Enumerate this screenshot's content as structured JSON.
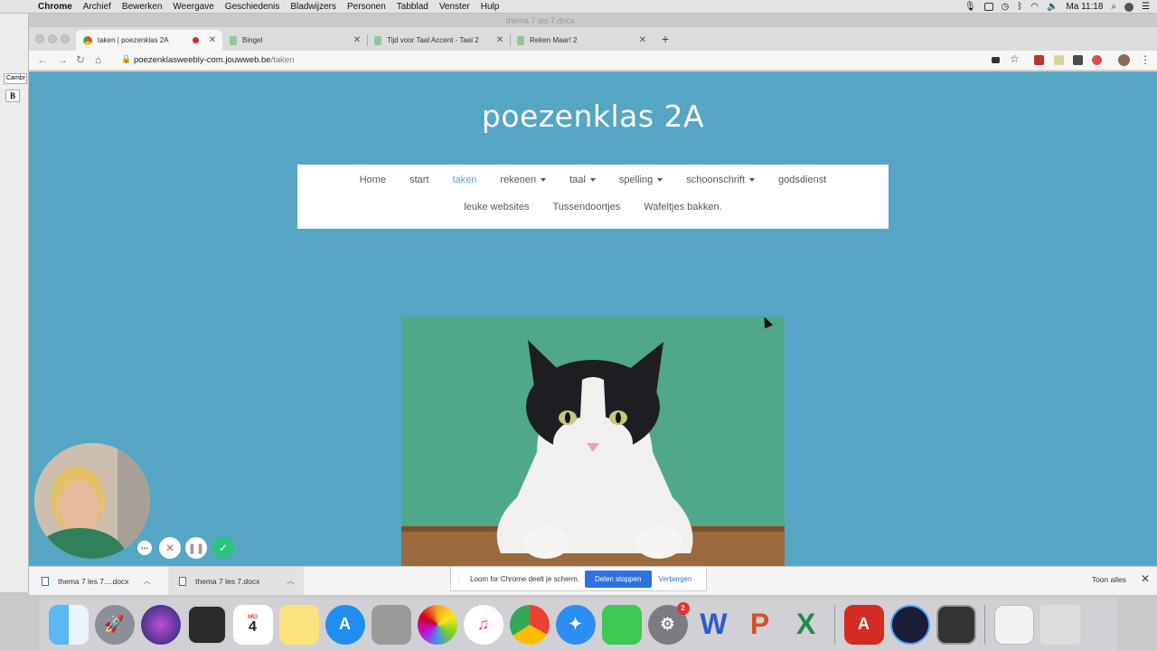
{
  "menubar": {
    "app": "Chrome",
    "items": [
      "Archief",
      "Bewerken",
      "Weergave",
      "Geschiedenis",
      "Bladwijzers",
      "Personen",
      "Tabblad",
      "Venster",
      "Hulp"
    ],
    "clock": "Ma 11:18"
  },
  "background_window": {
    "title": "thema 7 les 7.docx",
    "font_value": "Cambr",
    "bold_label": "B"
  },
  "browser": {
    "tabs": [
      {
        "title": "taken | poezenklas 2A",
        "active": true,
        "recording": true
      },
      {
        "title": "Bingel",
        "active": false
      },
      {
        "title": "Tijd voor Taal Accent - Taal 2",
        "active": false
      },
      {
        "title": "Reken Maar! 2",
        "active": false
      }
    ],
    "new_tab_label": "+",
    "url_host": "poezenklasweebly-com.jouwweb.be",
    "url_path": "/taken"
  },
  "site": {
    "title": "poezenklas 2A",
    "nav_row1": [
      {
        "label": "Home",
        "dropdown": false,
        "active": false
      },
      {
        "label": "start",
        "dropdown": false,
        "active": false
      },
      {
        "label": "taken",
        "dropdown": false,
        "active": true
      },
      {
        "label": "rekenen",
        "dropdown": true,
        "active": false
      },
      {
        "label": "taal",
        "dropdown": true,
        "active": false
      },
      {
        "label": "spelling",
        "dropdown": true,
        "active": false
      },
      {
        "label": "schoonschrift",
        "dropdown": true,
        "active": false
      },
      {
        "label": "godsdienst",
        "dropdown": false,
        "active": false
      }
    ],
    "nav_row2": [
      {
        "label": "leuke websites"
      },
      {
        "label": "Tussendoortjes"
      },
      {
        "label": "Wafeltjes bakken."
      }
    ]
  },
  "loom": {
    "banner_text": "Loom for Chrome deelt je scherm.",
    "stop_label": "Delen stoppen",
    "hide_label": "Verbergen"
  },
  "downloads": {
    "items": [
      "thema 7 les 7....docx",
      "thema 7 les 7.docx"
    ],
    "show_all_label": "Toon alles",
    "close_label": "✕"
  },
  "dock": {
    "calendar_month": "MEI",
    "calendar_day": "4",
    "settings_badge": "2"
  },
  "colors": {
    "page_bg": "#55a6c4",
    "accent_link": "#55a6c4",
    "loom_blue": "#2f6fe4",
    "loom_green": "#2ec27e"
  }
}
